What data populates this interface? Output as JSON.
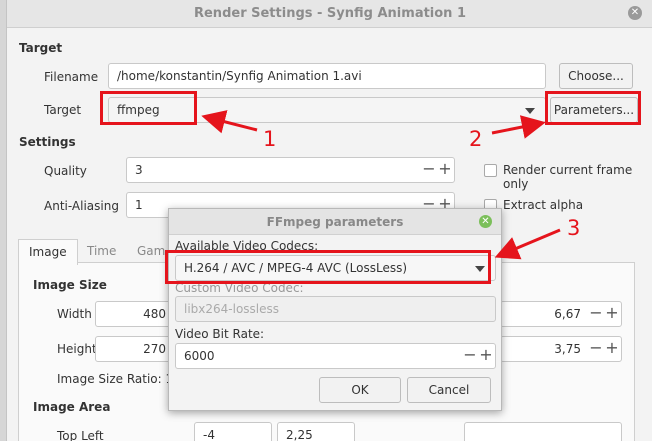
{
  "window": {
    "title": "Render Settings - Synfig Animation 1"
  },
  "target_section": {
    "heading": "Target",
    "filename_label": "Filename",
    "filename_value": "/home/konstantin/Synfig Animation 1.avi",
    "choose_button": "Choose...",
    "target_label": "Target",
    "target_value": "ffmpeg",
    "parameters_button": "Parameters..."
  },
  "settings_section": {
    "heading": "Settings",
    "quality_label": "Quality",
    "quality_value": "3",
    "antialias_label": "Anti-Aliasing",
    "antialias_value": "1",
    "render_current_frame": "Render current frame only",
    "extract_alpha": "Extract alpha"
  },
  "tabs": [
    "Image",
    "Time",
    "Gam"
  ],
  "image_tab": {
    "image_size_heading": "Image Size",
    "width_label": "Width",
    "width_value": "480",
    "width_right_value": "6,67",
    "height_label": "Height",
    "height_value": "270",
    "height_right_value": "3,75",
    "ratio_label": "Image Size Ratio: 1(",
    "image_area_heading": "Image Area",
    "top_left_label": "Top Left",
    "top_left_x": "-4",
    "top_left_y": "2,25"
  },
  "dialog": {
    "title": "FFmpeg parameters",
    "available_codecs_label": "Available Video Codecs:",
    "codec_value": "H.264 / AVC / MPEG-4 AVC (LossLess)",
    "custom_codec_label": "Custom Video Codec:",
    "custom_codec_value": "libx264-lossless",
    "bitrate_label": "Video Bit Rate:",
    "bitrate_value": "6000",
    "ok_button": "OK",
    "cancel_button": "Cancel"
  },
  "annotations": {
    "n1": "1",
    "n2": "2",
    "n3": "3"
  },
  "colors": {
    "annotation_red": "#e5141c",
    "dialog_close_green": "#7bbf5a"
  },
  "icons": [
    "close-icon",
    "dropdown-arrow-icon",
    "minus-icon",
    "plus-icon",
    "arrow-annotation-icon"
  ]
}
